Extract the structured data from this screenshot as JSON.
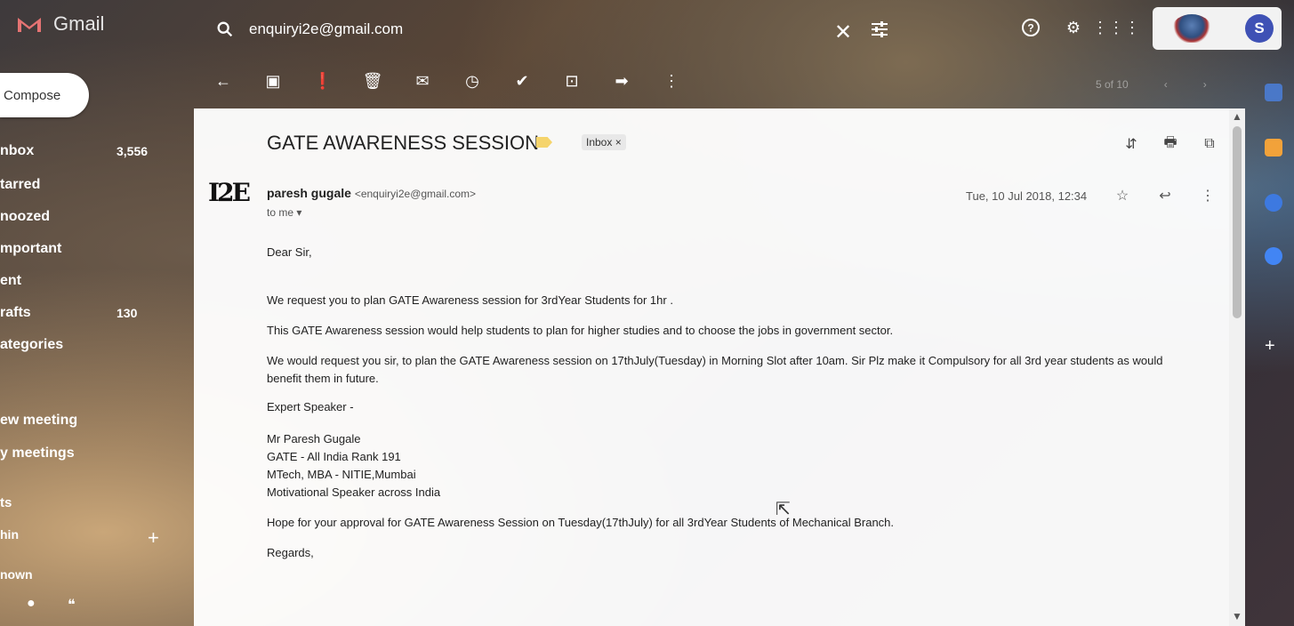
{
  "app": {
    "name": "Gmail"
  },
  "search": {
    "query": "enquiryi2e@gmail.com"
  },
  "account": {
    "avatar_letter": "S"
  },
  "pager": {
    "text": "5 of 10"
  },
  "compose": {
    "label": "Compose"
  },
  "nav": {
    "items": [
      {
        "label": "nbox",
        "count": "3,556"
      },
      {
        "label": "tarred",
        "count": ""
      },
      {
        "label": "noozed",
        "count": ""
      },
      {
        "label": "mportant",
        "count": ""
      },
      {
        "label": "ent",
        "count": ""
      },
      {
        "label": "rafts",
        "count": "130"
      },
      {
        "label": "ategories",
        "count": ""
      }
    ],
    "meet_new": "ew meeting",
    "meet_my": "y meetings",
    "chats_header": "ts",
    "chat_user1": "hin",
    "chat_user2": "nown"
  },
  "email": {
    "subject": "GATE AWARENESS SESSION",
    "label_chip": "Inbox ×",
    "sender_name": "paresh gugale",
    "sender_email": "<enquiryi2e@gmail.com>",
    "sender_avatar_text": "I2E",
    "to": "to me ▾",
    "date": "Tue, 10 Jul 2018, 12:34",
    "body": {
      "greeting": "Dear Sir,",
      "p1": "We request you to plan GATE Awareness session for 3rdYear Students for 1hr .",
      "p2": "This GATE Awareness session would help students to plan for higher studies and to choose the jobs in government sector.",
      "p3": "We would request you sir, to plan the GATE Awareness session on 17thJuly(Tuesday) in Morning Slot after 10am. Sir Plz make it Compulsory for all 3rd year students as would benefit them in future.",
      "expert": "Expert Speaker -",
      "sig1": "Mr Paresh Gugale",
      "sig2": "GATE - All India Rank 191",
      "sig3": "MTech, MBA - NITIE,Mumbai",
      "sig4": "Motivational Speaker across India",
      "p4": "Hope for your approval for GATE Awareness Session on Tuesday(17thJuly) for all 3rdYear Students of Mechanical Branch.",
      "regards": "Regards,"
    }
  },
  "colors": {
    "accent": "#3f51b5",
    "label": "#f5d46b"
  }
}
